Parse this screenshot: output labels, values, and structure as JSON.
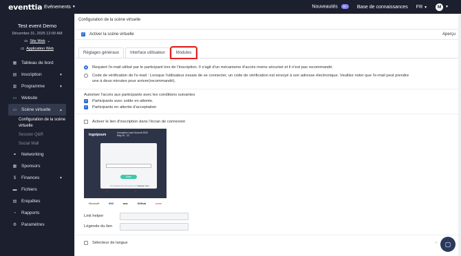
{
  "topbar": {
    "logo": "eventtia",
    "events_menu": "Evénements",
    "nouveautes": "Nouveautés",
    "nouveautes_badge": "9+",
    "knowledge_base": "Base de connaissances",
    "language": "FR",
    "avatar_initial": "M"
  },
  "sidebar": {
    "event_title": "Test event Demo",
    "event_date": "Décembre 31, 2025 12:00 AM",
    "site_web": "Site Web",
    "application_web": "Application Web",
    "items": [
      {
        "label": "Tableau de bord",
        "icon": "grid-icon"
      },
      {
        "label": "Inscription",
        "icon": "inscription-icon",
        "chevron": true
      },
      {
        "label": "Programme",
        "icon": "calendar-icon",
        "chevron": true
      },
      {
        "label": "Website",
        "icon": "monitor-icon"
      },
      {
        "label": "Scène virtuelle",
        "icon": "virtual-stage-icon",
        "chevron": true,
        "active": true
      },
      {
        "label": "Networking",
        "icon": "networking-icon"
      },
      {
        "label": "Sponsors",
        "icon": "sponsors-icon"
      },
      {
        "label": "Finances",
        "icon": "dollar-icon",
        "chevron": true
      },
      {
        "label": "Fichiers",
        "icon": "folder-icon"
      },
      {
        "label": "Enquêtes",
        "icon": "survey-icon"
      },
      {
        "label": "Rapports",
        "icon": "pie-chart-icon"
      },
      {
        "label": "Paramètres",
        "icon": "gear-icon"
      }
    ],
    "sub_items": [
      {
        "label": "Configuration de la scène virtuelle",
        "dim": false
      },
      {
        "label": "Session Q&R",
        "dim": true
      },
      {
        "label": "Social Wall",
        "dim": true
      }
    ]
  },
  "main": {
    "breadcrumb": "Configuration de la scène virtuelle",
    "activate_label": "Activer la scène virtuelle",
    "apercu": "Aperçu",
    "tabs": [
      "Réglages généraux",
      "Interface utilisateur",
      "Modules"
    ],
    "radio_1": "Requiert l'e-mail utilisé par le participant lors de l'inscription. Il s'agit d'un mécanisme d'accès moins sécurisé et il n'est pas recommandé.",
    "radio_2": "Code de vérification de l'e-mail : Lorsque l'utilisateur essaie de se connecter, un code de vérification est envoyé à son adresse électronique. Veuillez noter que l'e-mail peut prendre une à deux minutes pour arriver(recommandé).",
    "allow_label": "Autoriser l'accès aux participants avec les conditions suivantes",
    "cond_1": "Participants avec solde en attente.",
    "cond_2": "Participants en attente d'acceptation",
    "enable_link": "Activer le lien d'inscription dans l'écran de connexion",
    "link_helper": "Link helper",
    "link_legend": "Légende du lien",
    "language_selector": "Sélecteur de langue"
  },
  "preview": {
    "logo": "logoipsum",
    "summit_title": "Innovation Lead Summit 2020",
    "summit_date": "May 20 - 22",
    "enter_btn": "Enter",
    "register_text": "Not registered to the event yet?",
    "register_link": "Register here.",
    "num_1": "1",
    "num_2": "2",
    "sponsors": [
      "Microsoft",
      "IBM",
      "aws",
      "GitHub",
      "zoom"
    ]
  },
  "colors": {
    "sidebar_bg": "#1b1f2e",
    "accent": "#2c6fd8",
    "highlight": "#e02020"
  }
}
